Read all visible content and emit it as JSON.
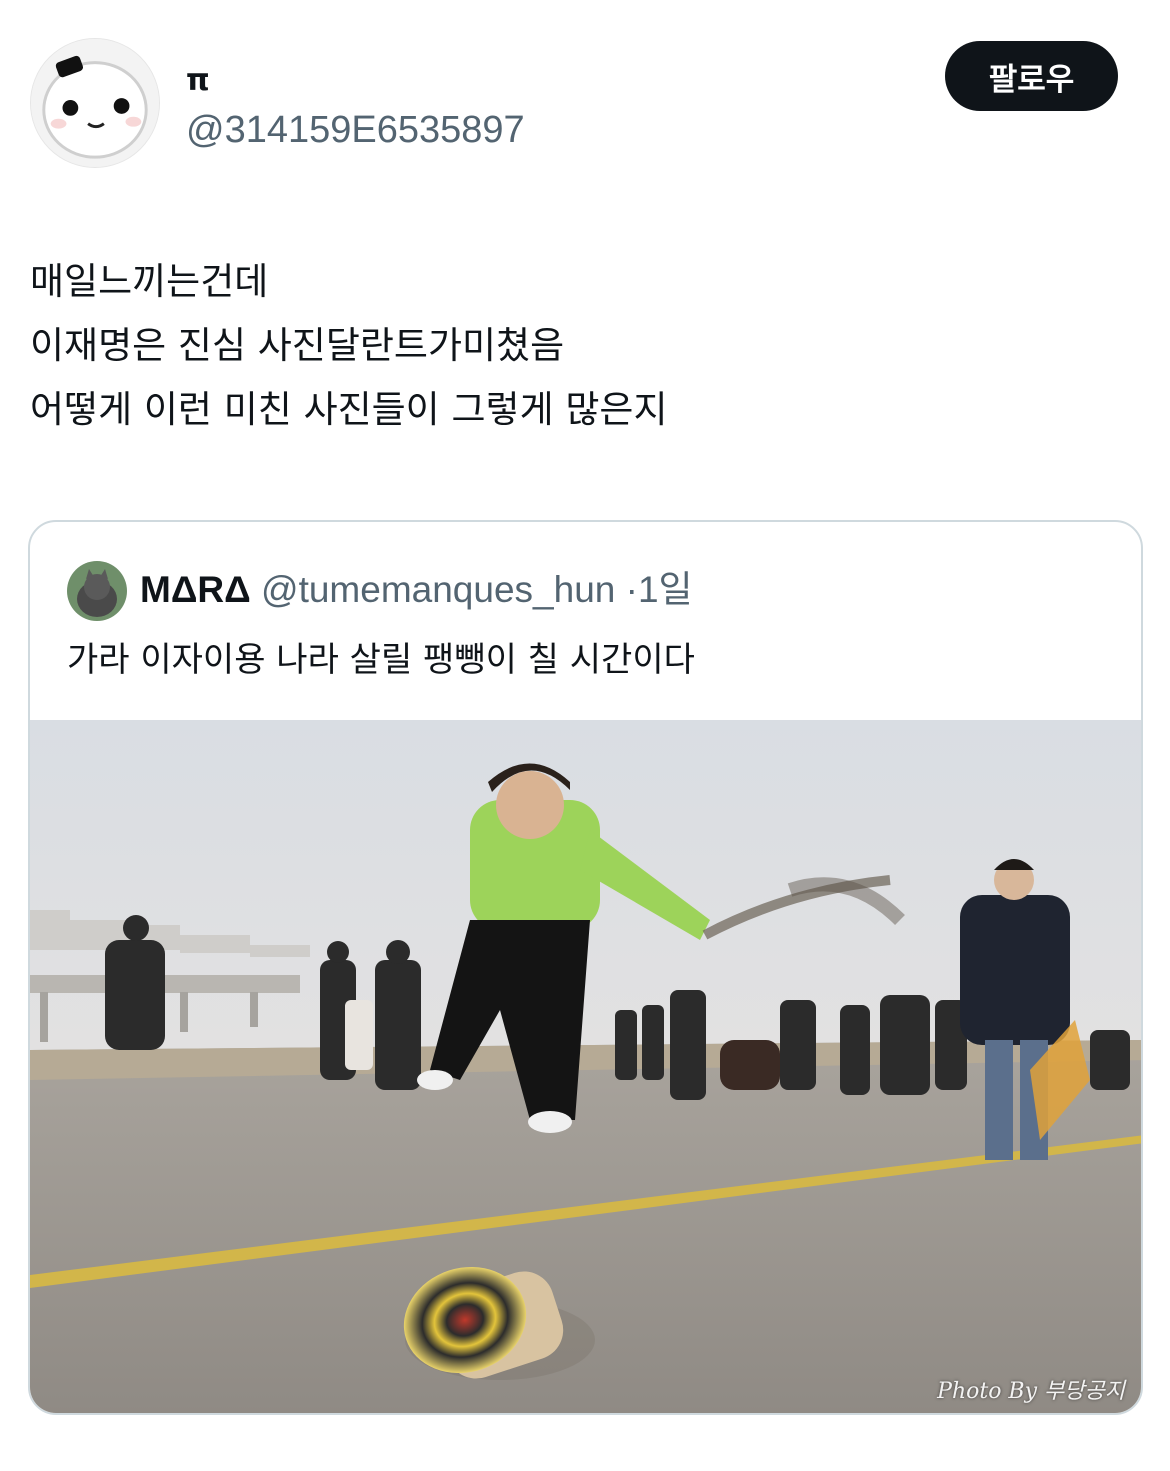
{
  "user": {
    "display_name": "π",
    "handle": "@314159E6535897"
  },
  "follow_label": "팔로우",
  "tweet_lines": [
    "매일느끼는건데",
    "이재명은 진심 사진달란트가미쳤음",
    "어떻게 이런 미친 사진들이 그렇게 많은지"
  ],
  "quoted": {
    "display_name": "MΔRΔ",
    "handle": "@tumemanques_hun",
    "separator": "·",
    "time": "1일",
    "text": "가라 이자이용 나라 살릴 팽뺑이 칠 시간이다",
    "photo_watermark": "Photo By 부당공지"
  }
}
